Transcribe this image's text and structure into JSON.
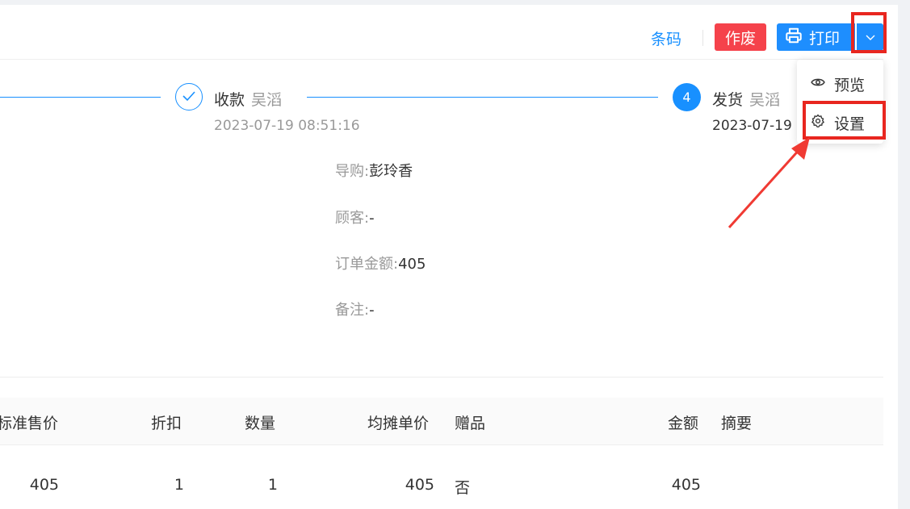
{
  "toolbar": {
    "barcode_label": "条码",
    "void_label": "作废",
    "print_label": "打印"
  },
  "dropdown": {
    "items": [
      {
        "label": "预览",
        "icon": "eye-icon"
      },
      {
        "label": "设置",
        "icon": "gear-icon"
      }
    ]
  },
  "steps": [
    {
      "title": "收款",
      "operator": "吴滔",
      "time": "2023-07-19 08:51:16",
      "status": "done"
    },
    {
      "number": "4",
      "title": "发货",
      "operator": "吴滔",
      "time": "2023-07-19",
      "status": "current"
    }
  ],
  "info": {
    "guide_label": "导购:",
    "guide_value": "彭玲香",
    "customer_label": "顾客:",
    "customer_value": "-",
    "amount_label": "订单金额:",
    "amount_value": "405",
    "remark_label": "备注:",
    "remark_value": "-"
  },
  "table": {
    "columns": [
      "标准售价",
      "折扣",
      "数量",
      "均摊单价",
      "赠品",
      "金额",
      "摘要"
    ],
    "rows": [
      [
        "405",
        "1",
        "1",
        "405",
        "否",
        "405",
        ""
      ]
    ]
  },
  "colors": {
    "primary": "#1890ff",
    "danger": "#f5424b",
    "annotation": "#e8261f"
  }
}
